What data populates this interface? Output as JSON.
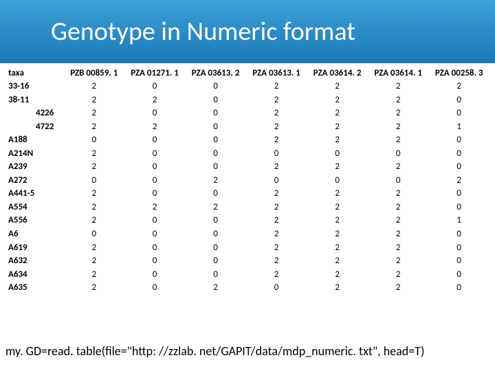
{
  "title": "Genotype in Numeric format",
  "headers": [
    "taxa",
    "PZB 00859. 1",
    "PZA 01271. 1",
    "PZA 03613. 2",
    "PZA 03613. 1",
    "PZA 03614. 2",
    "PZA 03614. 1",
    "PZA 00258. 3"
  ],
  "rows": [
    {
      "taxa": "33-16",
      "indent": false,
      "v": [
        "2",
        "0",
        "0",
        "2",
        "2",
        "2",
        "2"
      ]
    },
    {
      "taxa": "38-11",
      "indent": false,
      "v": [
        "2",
        "2",
        "0",
        "2",
        "2",
        "2",
        "0"
      ]
    },
    {
      "taxa": "4226",
      "indent": true,
      "v": [
        "2",
        "0",
        "0",
        "2",
        "2",
        "2",
        "0"
      ]
    },
    {
      "taxa": "4722",
      "indent": true,
      "v": [
        "2",
        "2",
        "0",
        "2",
        "2",
        "2",
        "1"
      ]
    },
    {
      "taxa": "A188",
      "indent": false,
      "v": [
        "0",
        "0",
        "0",
        "2",
        "2",
        "2",
        "0"
      ]
    },
    {
      "taxa": "A214N",
      "indent": false,
      "v": [
        "2",
        "0",
        "0",
        "0",
        "0",
        "0",
        "0"
      ]
    },
    {
      "taxa": "A239",
      "indent": false,
      "v": [
        "2",
        "0",
        "0",
        "2",
        "2",
        "2",
        "0"
      ]
    },
    {
      "taxa": "A272",
      "indent": false,
      "v": [
        "0",
        "0",
        "2",
        "0",
        "0",
        "0",
        "2"
      ]
    },
    {
      "taxa": "A441-5",
      "indent": false,
      "v": [
        "2",
        "0",
        "0",
        "2",
        "2",
        "2",
        "0"
      ]
    },
    {
      "taxa": "A554",
      "indent": false,
      "v": [
        "2",
        "2",
        "2",
        "2",
        "2",
        "2",
        "0"
      ]
    },
    {
      "taxa": "A556",
      "indent": false,
      "v": [
        "2",
        "0",
        "0",
        "2",
        "2",
        "2",
        "1"
      ]
    },
    {
      "taxa": "A6",
      "indent": false,
      "v": [
        "0",
        "0",
        "0",
        "2",
        "2",
        "2",
        "0"
      ]
    },
    {
      "taxa": "A619",
      "indent": false,
      "v": [
        "2",
        "0",
        "0",
        "2",
        "2",
        "2",
        "0"
      ]
    },
    {
      "taxa": "A632",
      "indent": false,
      "v": [
        "2",
        "0",
        "0",
        "2",
        "2",
        "2",
        "0"
      ]
    },
    {
      "taxa": "A634",
      "indent": false,
      "v": [
        "2",
        "0",
        "0",
        "2",
        "2",
        "2",
        "0"
      ]
    },
    {
      "taxa": "A635",
      "indent": false,
      "v": [
        "2",
        "0",
        "2",
        "0",
        "2",
        "2",
        "0"
      ]
    }
  ],
  "code_line": "my. GD=read. table(file=\"http: //zzlab. net/GAPIT/data/mdp_numeric. txt\", head=T)"
}
